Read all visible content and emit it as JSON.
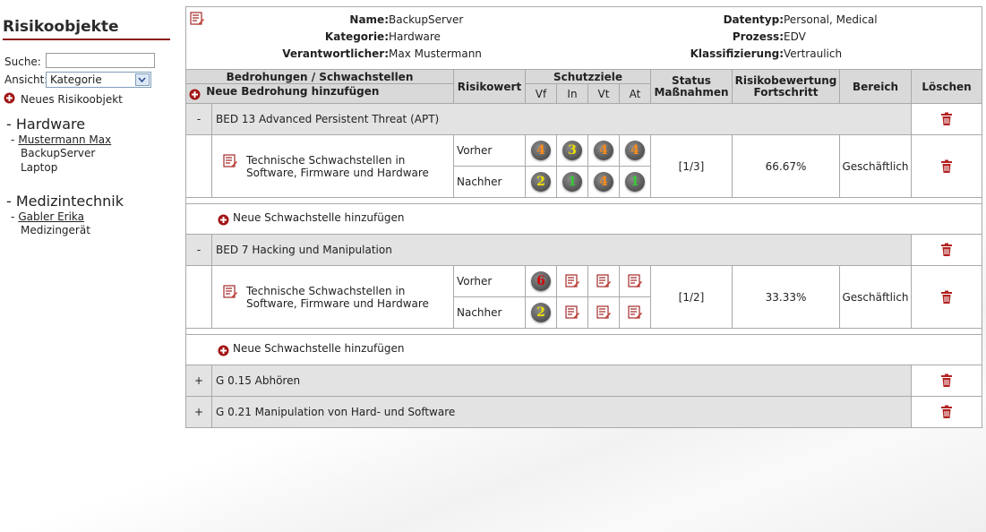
{
  "sidebar": {
    "title": "Risikoobjekte",
    "search_label": "Suche:",
    "search_value": "",
    "view_label": "Ansicht:",
    "view_value": "Kategorie",
    "new_object": "Neues Risikoobjekt",
    "categories": [
      {
        "label": "- Hardware",
        "person_prefix": "-",
        "person": "Mustermann Max",
        "objects": [
          "BackupServer",
          "Laptop"
        ]
      },
      {
        "label": "- Medizintechnik",
        "person_prefix": "-",
        "person": "Gabler Erika",
        "objects": [
          "Medizingerät"
        ]
      }
    ]
  },
  "info": {
    "name_label": "Name:",
    "name": "BackupServer",
    "kategorie_label": "Kategorie:",
    "kategorie": "Hardware",
    "verantwortlicher_label": "Verantwortlicher:",
    "verantwortlicher": "Max Mustermann",
    "datentyp_label": "Datentyp:",
    "datentyp": "Personal, Medical",
    "prozess_label": "Prozess:",
    "prozess": "EDV",
    "klassifizierung_label": "Klassifizierung:",
    "klassifizierung": "Vertraulich"
  },
  "table": {
    "headers": {
      "threats": "Bedrohungen / Schwachstellen",
      "new_threat": "Neue Bedrohung hinzufügen",
      "risk_value": "Risikowert",
      "protection_goals": "Schutzziele",
      "goals": [
        "Vf",
        "In",
        "Vt",
        "At"
      ],
      "status": "Status Maßnahmen",
      "rating": "Risikobewertung Fortschritt",
      "area": "Bereich",
      "delete": "Löschen"
    },
    "threats": [
      {
        "sign": "-",
        "name": "BED 13 Advanced Persistent Threat (APT)",
        "vulnerability": "Technische Schwachstellen in Software, Firmware und Hardware",
        "before_label": "Vorher",
        "after_label": "Nachher",
        "before": [
          "4",
          "3",
          "4",
          "4"
        ],
        "after": [
          "2",
          "1",
          "4",
          "1"
        ],
        "status": "[1/3]",
        "progress": "66.67%",
        "area": "Geschäftlich",
        "add_vulnerability": "Neue Schwachstelle hinzufügen"
      },
      {
        "sign": "-",
        "name": "BED 7 Hacking und Manipulation",
        "vulnerability": "Technische Schwachstellen in Software, Firmware und Hardware",
        "before_label": "Vorher",
        "after_label": "Nachher",
        "before": [
          "6",
          "",
          "",
          ""
        ],
        "after": [
          "2",
          "",
          "",
          ""
        ],
        "status": "[1/2]",
        "progress": "33.33%",
        "area": "Geschäftlich",
        "add_vulnerability": "Neue Schwachstelle hinzufügen"
      },
      {
        "sign": "+",
        "name": "G 0.15 Abhören"
      },
      {
        "sign": "+",
        "name": "G 0.21 Manipulation von Hard- und Software"
      }
    ]
  },
  "colors": {
    "accent_red": "#8b1a1a",
    "score_4": "#ff8c1a",
    "score_3": "#f2e000",
    "score_2": "#f2e000",
    "score_1": "#33cc33",
    "score_6": "#d40000",
    "header_bg": "#d9d9d9",
    "threat_bg": "#e3e3e3"
  }
}
